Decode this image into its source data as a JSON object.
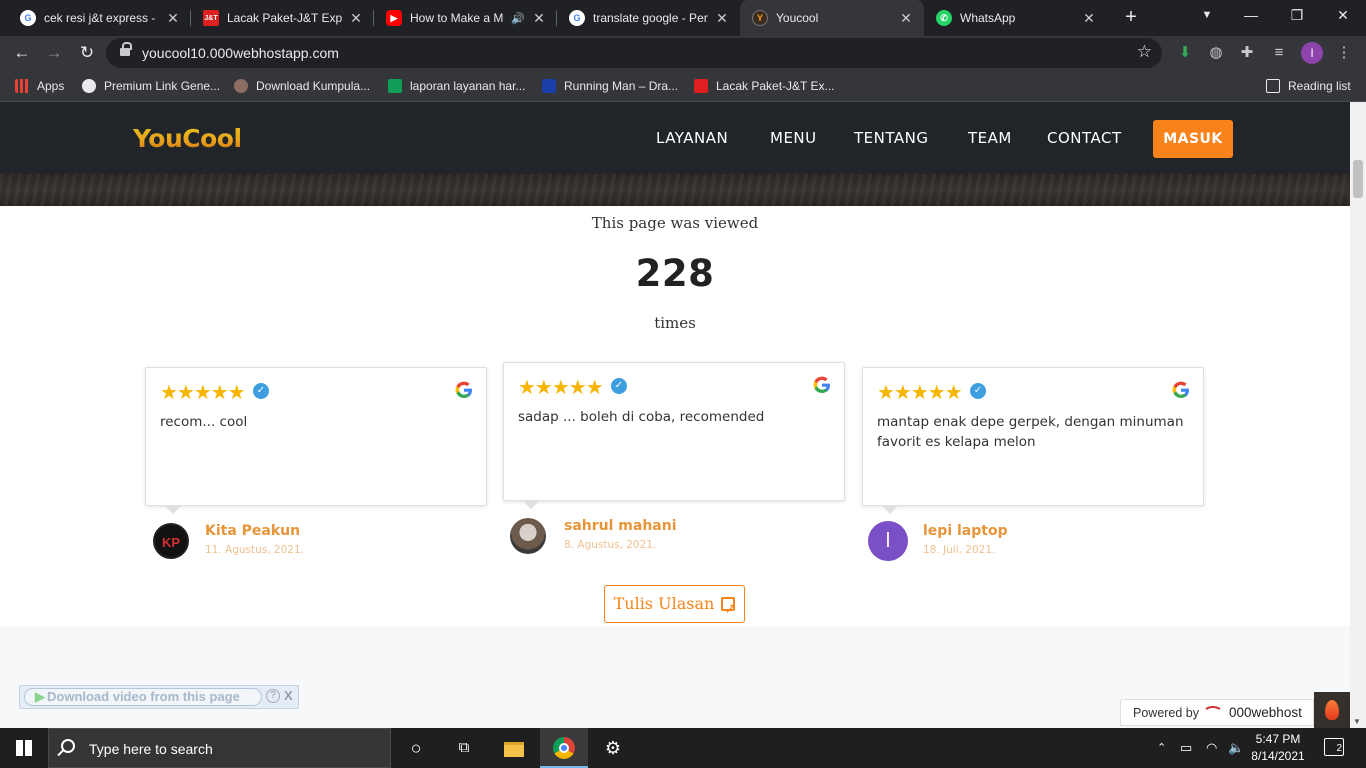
{
  "browser": {
    "tabs": [
      {
        "title": "cek resi j&t express - P",
        "favicon": "google-icon",
        "active": false
      },
      {
        "title": "Lacak Paket-J&T Expre",
        "favicon": "jt-icon",
        "active": false
      },
      {
        "title": "How to Make a M",
        "favicon": "youtube-icon",
        "active": false,
        "audio": true
      },
      {
        "title": "translate google - Pen",
        "favicon": "google-icon",
        "active": false
      },
      {
        "title": "Youcool",
        "favicon": "youcool-icon",
        "active": true
      },
      {
        "title": "WhatsApp",
        "favicon": "whatsapp-icon",
        "active": false
      }
    ],
    "url": "youcool10.000webhostapp.com",
    "profile_initial": "I",
    "bookmarks": [
      {
        "label": "Apps",
        "icon": "apps-grid-icon"
      },
      {
        "label": "Premium Link Gene...",
        "icon": "globe-icon"
      },
      {
        "label": "Download Kumpula...",
        "icon": "avatar-icon"
      },
      {
        "label": "laporan layanan har...",
        "icon": "sheets-icon"
      },
      {
        "label": "Running Man – Dra...",
        "icon": "runningman-icon"
      },
      {
        "label": "Lacak Paket-J&T Ex...",
        "icon": "jt-icon"
      }
    ],
    "reading_list": "Reading list"
  },
  "site": {
    "logo": "YouCool",
    "nav": [
      "LAYANAN",
      "MENU",
      "TENTANG",
      "TEAM",
      "CONTACT"
    ],
    "login_button": "MASUK",
    "accent_color": "#f7831a",
    "counter": {
      "lead": "This page was viewed",
      "count": "228",
      "tail": "times"
    },
    "reviews": [
      {
        "rating": 5,
        "text": "recom... cool",
        "name": "Kita Peakun",
        "date": "11. Agustus, 2021.",
        "avatar": "KP"
      },
      {
        "rating": 5,
        "text": "sadap ... boleh di coba, recomended",
        "name": "sahrul mahani",
        "date": "8. Agustus, 2021.",
        "avatar": ""
      },
      {
        "rating": 5,
        "text": "mantap enak depe gerpek, dengan minuman favorit es kelapa melon",
        "name": "lepi laptop",
        "date": "18. Juli, 2021.",
        "avatar": "l"
      }
    ],
    "write_review": "Tulis Ulasan",
    "powered_by": "Powered by",
    "host_brand": "000webhost"
  },
  "download_bar": {
    "label": "Download video from this page",
    "help": "?",
    "close": "X"
  },
  "taskbar": {
    "search_placeholder": "Type here to search",
    "time": "5:47 PM",
    "date": "8/14/2021",
    "notifications": "2"
  }
}
